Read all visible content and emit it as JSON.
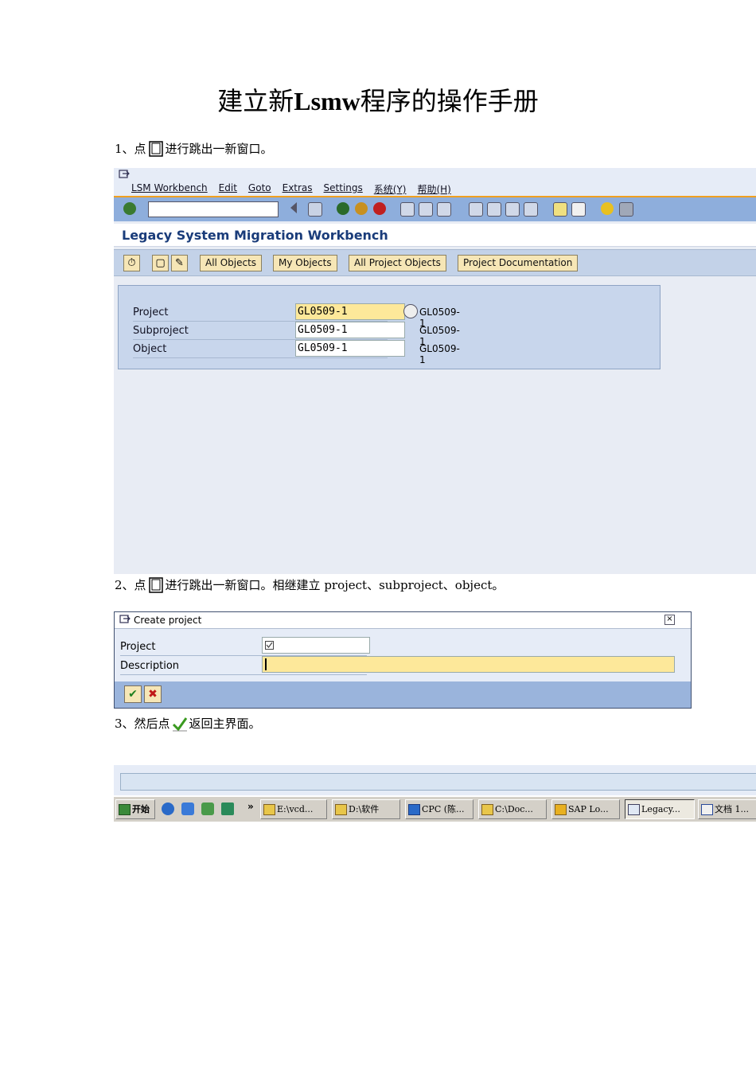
{
  "doc_title_pre": "建立新",
  "doc_title_bold": "Lsmw",
  "doc_title_post": "程序的操作手册",
  "step1": {
    "num": "1、点",
    "text": "进行跳出一新窗口。"
  },
  "step2": {
    "num": "2、点",
    "text": "进行跳出一新窗口。相继建立 project、subproject、object。"
  },
  "step3": {
    "num": "3、然后点",
    "text": "返回主界面。"
  },
  "sap1": {
    "menu": [
      "LSM Workbench",
      "Edit",
      "Goto",
      "Extras",
      "Settings",
      "系统(Y)",
      "帮助(H)"
    ],
    "page_title": "Legacy System Migration Workbench",
    "buttons": [
      "All Objects",
      "My Objects",
      "All Project Objects",
      "Project Documentation"
    ],
    "fields": [
      {
        "label": "Project",
        "value": "GL0509-1",
        "desc": "GL0509-1"
      },
      {
        "label": "Subproject",
        "value": "GL0509-1",
        "desc": "GL0509-1"
      },
      {
        "label": "Object",
        "value": "GL0509-1",
        "desc": "GL0509-1"
      }
    ]
  },
  "dialog": {
    "title": "Create project",
    "fields": [
      {
        "label": "Project",
        "value": ""
      },
      {
        "label": "Description",
        "value": ""
      }
    ]
  },
  "taskbar": {
    "start": "开始",
    "items": [
      "E:\\vcd...",
      "D:\\软件",
      "CPC (陈...",
      "C:\\Doc...",
      "SAP Lo...",
      "Legacy...",
      "文档 1..."
    ]
  }
}
